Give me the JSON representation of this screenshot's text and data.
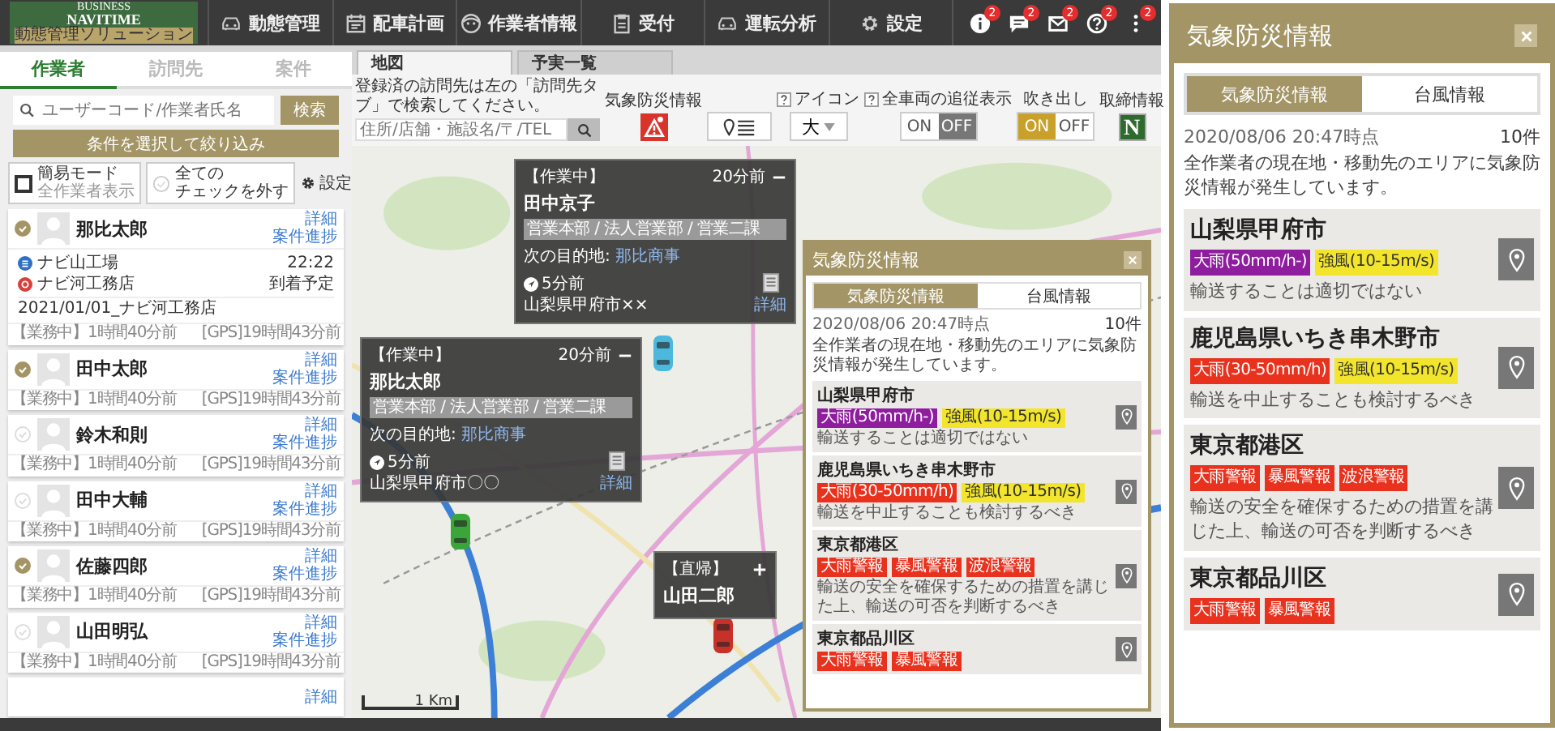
{
  "nav": {
    "logo": {
      "top": "BUSINESS",
      "title": "NAVITIME",
      "subtitle": "動態管理ソリューション"
    },
    "items": [
      {
        "label": "動態管理"
      },
      {
        "label": "配車計画"
      },
      {
        "label": "作業者情報"
      },
      {
        "label": "受付"
      },
      {
        "label": "運転分析"
      },
      {
        "label": "設定"
      }
    ],
    "notices": [
      {
        "count": "2"
      },
      {
        "count": "2"
      },
      {
        "count": "2"
      },
      {
        "count": "2"
      },
      {
        "count": "2"
      }
    ]
  },
  "sidebar": {
    "tabs": [
      {
        "label": "作業者",
        "selected": true
      },
      {
        "label": "訪問先",
        "selected": false
      },
      {
        "label": "案件",
        "selected": false
      }
    ],
    "search": {
      "placeholder": "ユーザーコード/作業者氏名",
      "button": "検索"
    },
    "filter_button": "条件を選択して絞り込み",
    "simple_mode": {
      "label": "簡易モード",
      "sublabel": "全作業者表示",
      "checked": false
    },
    "uncheck_all": [
      "全ての",
      "チェックを外す"
    ],
    "settings": "設定",
    "workers": [
      {
        "name": "那比太郎",
        "checked": true,
        "links": [
          "詳細",
          "案件進捗"
        ],
        "route": {
          "origin": "ナビ山工場",
          "destination": "ナビ河工務店",
          "time": "22:22",
          "time_label": "到着予定",
          "note": "2021/01/01_ナビ河工務店"
        },
        "status": "【業務中】1時間40分前",
        "gps": "[GPS]19時間43分前"
      },
      {
        "name": "田中太郎",
        "checked": true,
        "links": [
          "詳細",
          "案件進捗"
        ],
        "status": "【業務中】1時間40分前",
        "gps": "[GPS]19時間43分前"
      },
      {
        "name": "鈴木和則",
        "checked": false,
        "links": [
          "詳細",
          "案件進捗"
        ],
        "status": "【業務中】1時間40分前",
        "gps": "[GPS]19時間43分前"
      },
      {
        "name": "田中大輔",
        "checked": false,
        "links": [
          "詳細",
          "案件進捗"
        ],
        "status": "【業務中】1時間40分前",
        "gps": "[GPS]19時間43分前"
      },
      {
        "name": "佐藤四郎",
        "checked": true,
        "links": [
          "詳細",
          "案件進捗"
        ],
        "status": "【業務中】1時間40分前",
        "gps": "[GPS]19時間43分前"
      },
      {
        "name": "山田明弘",
        "checked": false,
        "links": [
          "詳細",
          "案件進捗"
        ],
        "status": "【業務中】1時間40分前",
        "gps": "[GPS]19時間43分前"
      },
      {
        "links": [
          "詳細"
        ]
      }
    ]
  },
  "map": {
    "tabs": [
      {
        "label": "地図",
        "selected": true
      },
      {
        "label": "予実一覧",
        "selected": false
      }
    ],
    "toolbar": {
      "hint": "登録済の訪問先は左の「訪問先タブ」で検索してください。",
      "address_placeholder": "住所/店舗・施設名/〒/TEL",
      "weather_label": "気象防災情報",
      "icon_size": {
        "label": "アイコン",
        "value": "大"
      },
      "follow": {
        "label": "全車両の追従表示",
        "options": [
          {
            "label": "ON",
            "selected": false
          },
          {
            "label": "OFF",
            "selected": true
          }
        ]
      },
      "balloon": {
        "label": "吹き出し",
        "options": [
          {
            "label": "ON",
            "selected": true
          },
          {
            "label": "OFF",
            "selected": false
          }
        ]
      },
      "enforcement": {
        "label": "取締情報",
        "badge": "N"
      }
    },
    "popups": [
      {
        "kind": "full",
        "status": "【作業中】",
        "time": "20分前",
        "name": "田中京子",
        "department": "営業本部 / 法人営業部 / 営業二課",
        "next_label": "次の目的地:",
        "next_link": "那比商事",
        "updated": "5分前",
        "address": "山梨県甲府市××",
        "detail": "詳細",
        "expanded": true,
        "vehicle": {
          "color": "#4cb8dc"
        }
      },
      {
        "kind": "full",
        "status": "【作業中】",
        "time": "20分前",
        "name": "那比太郎",
        "department": "営業本部 / 法人営業部 / 営業二課",
        "next_label": "次の目的地:",
        "next_link": "那比商事",
        "updated": "5分前",
        "address": "山梨県甲府市〇〇",
        "detail": "詳細",
        "expanded": true,
        "vehicle": {
          "color": "#3aa63a"
        }
      },
      {
        "kind": "compact",
        "status": "【直帰】",
        "name": "山田二郎",
        "expanded": false,
        "vehicle": {
          "color": "#c8302a"
        }
      }
    ],
    "scale": "1 Km",
    "weather_popup": {
      "title": "気象防災情報",
      "tabs": [
        {
          "label": "気象防災情報",
          "selected": true
        },
        {
          "label": "台風情報",
          "selected": false
        }
      ],
      "timestamp": "2020/08/06 20:47時点",
      "count": "10件",
      "description": "全作業者の現在地・移動先のエリアに気象防災情報が発生しています。",
      "areas": [
        {
          "name": "山梨県甲府市",
          "tags": [
            {
              "text": "大雨(50mm/h-)",
              "color": "#8e1e9e"
            },
            {
              "text": "強風(10-15m/s)",
              "color": "#f2e52c"
            }
          ],
          "note": "輸送することは適切ではない"
        },
        {
          "name": "鹿児島県いちき串木野市",
          "tags": [
            {
              "text": "大雨(30-50mm/h)",
              "color": "#e8321e"
            },
            {
              "text": "強風(10-15m/s)",
              "color": "#f2e52c"
            }
          ],
          "note": "輸送を中止することも検討するべき"
        },
        {
          "name": "東京都港区",
          "tags": [
            {
              "text": "大雨警報",
              "color": "#e8321e"
            },
            {
              "text": "暴風警報",
              "color": "#e8321e"
            },
            {
              "text": "波浪警報",
              "color": "#e8321e"
            }
          ],
          "note": "輸送の安全を確保するための措置を講じた上、輸送の可否を判断するべき"
        },
        {
          "name": "東京都品川区",
          "tags": [
            {
              "text": "大雨警報",
              "color": "#e8321e"
            },
            {
              "text": "暴風警報",
              "color": "#e8321e"
            }
          ]
        }
      ]
    }
  },
  "weather_panel": {
    "title": "気象防災情報",
    "tabs": [
      {
        "label": "気象防災情報",
        "selected": true
      },
      {
        "label": "台風情報",
        "selected": false
      }
    ],
    "timestamp": "2020/08/06 20:47時点",
    "count": "10件",
    "description": "全作業者の現在地・移動先のエリアに気象防災情報が発生しています。",
    "areas": [
      {
        "name": "山梨県甲府市",
        "tags": [
          {
            "text": "大雨(50mm/h-)",
            "color": "#8e1e9e"
          },
          {
            "text": "強風(10-15m/s)",
            "color": "#f2e52c"
          }
        ],
        "note": "輸送することは適切ではない"
      },
      {
        "name": "鹿児島県いちき串木野市",
        "tags": [
          {
            "text": "大雨(30-50mm/h)",
            "color": "#e8321e"
          },
          {
            "text": "強風(10-15m/s)",
            "color": "#f2e52c"
          }
        ],
        "note": "輸送を中止することも検討するべき"
      },
      {
        "name": "東京都港区",
        "tags": [
          {
            "text": "大雨警報",
            "color": "#e8321e"
          },
          {
            "text": "暴風警報",
            "color": "#e8321e"
          },
          {
            "text": "波浪警報",
            "color": "#e8321e"
          }
        ],
        "note": "輸送の安全を確保するための措置を講じた上、輸送の可否を判断するべき"
      },
      {
        "name": "東京都品川区",
        "tags": [
          {
            "text": "大雨警報",
            "color": "#e8321e"
          },
          {
            "text": "暴風警報",
            "color": "#e8321e"
          }
        ]
      }
    ]
  }
}
